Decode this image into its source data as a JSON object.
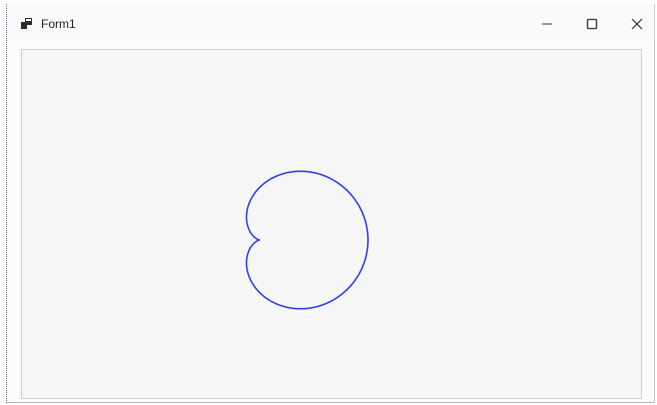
{
  "window": {
    "title": "Form1"
  },
  "icons": {
    "app": "form-app-icon",
    "minimize": "minimize-icon",
    "maximize": "maximize-icon",
    "close": "close-icon"
  },
  "colors": {
    "curve": "#2f3ff0",
    "client_background": "#f7f6f7",
    "titlebar_background": "#fafafa"
  },
  "drawing": {
    "shape": "cardioid"
  }
}
